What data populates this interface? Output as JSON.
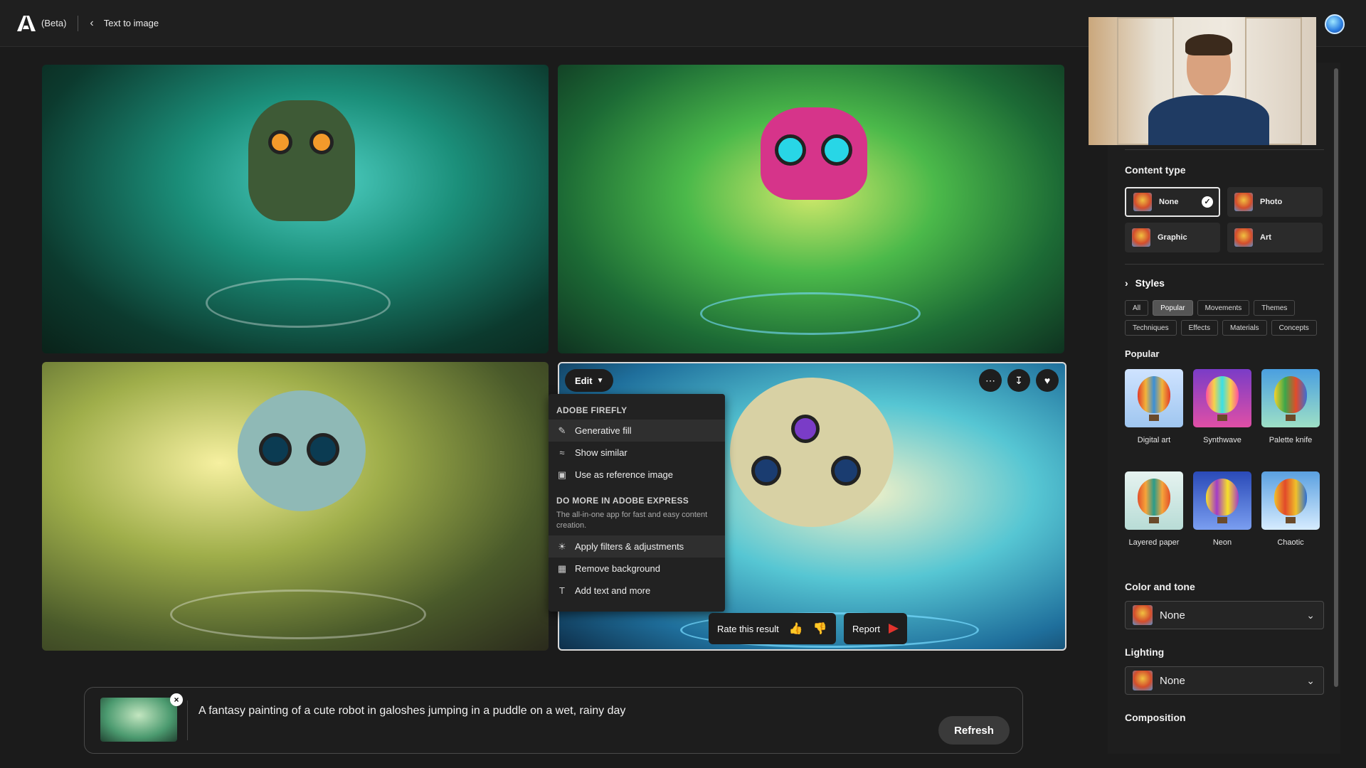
{
  "app": {
    "beta": "(Beta)",
    "breadcrumb": "Text to image"
  },
  "image_toolbar": {
    "edit_label": "Edit"
  },
  "menu": {
    "section1": "ADOBE FIREFLY",
    "items1": [
      "Generative fill",
      "Show similar",
      "Use as reference image"
    ],
    "section2": "DO MORE IN ADOBE EXPRESS",
    "section2_desc": "The all-in-one app for fast and easy content creation.",
    "items2": [
      "Apply filters & adjustments",
      "Remove background",
      "Add text and more"
    ]
  },
  "feedback": {
    "rate_label": "Rate this result",
    "report_label": "Report"
  },
  "prompt": {
    "text": "A fantasy painting of a cute robot in galoshes jumping in a puddle on a wet, rainy day",
    "refresh_label": "Refresh"
  },
  "panel": {
    "content_type": {
      "title": "Content type",
      "options": [
        "None",
        "Photo",
        "Graphic",
        "Art"
      ],
      "selected": "None"
    },
    "styles": {
      "title": "Styles",
      "tabs": [
        "All",
        "Popular",
        "Movements",
        "Themes",
        "Techniques",
        "Effects",
        "Materials",
        "Concepts"
      ],
      "active_tab": "Popular",
      "section_title": "Popular",
      "items": [
        "Digital art",
        "Synthwave",
        "Palette knife",
        "Layered paper",
        "Neon",
        "Chaotic"
      ]
    },
    "color_tone": {
      "title": "Color and tone",
      "value": "None"
    },
    "lighting": {
      "title": "Lighting",
      "value": "None"
    },
    "composition": {
      "title": "Composition"
    }
  },
  "colors": {
    "background": "#1b1b1b",
    "panel": "#1e1e1e",
    "accent_flag": "#e0332d"
  }
}
